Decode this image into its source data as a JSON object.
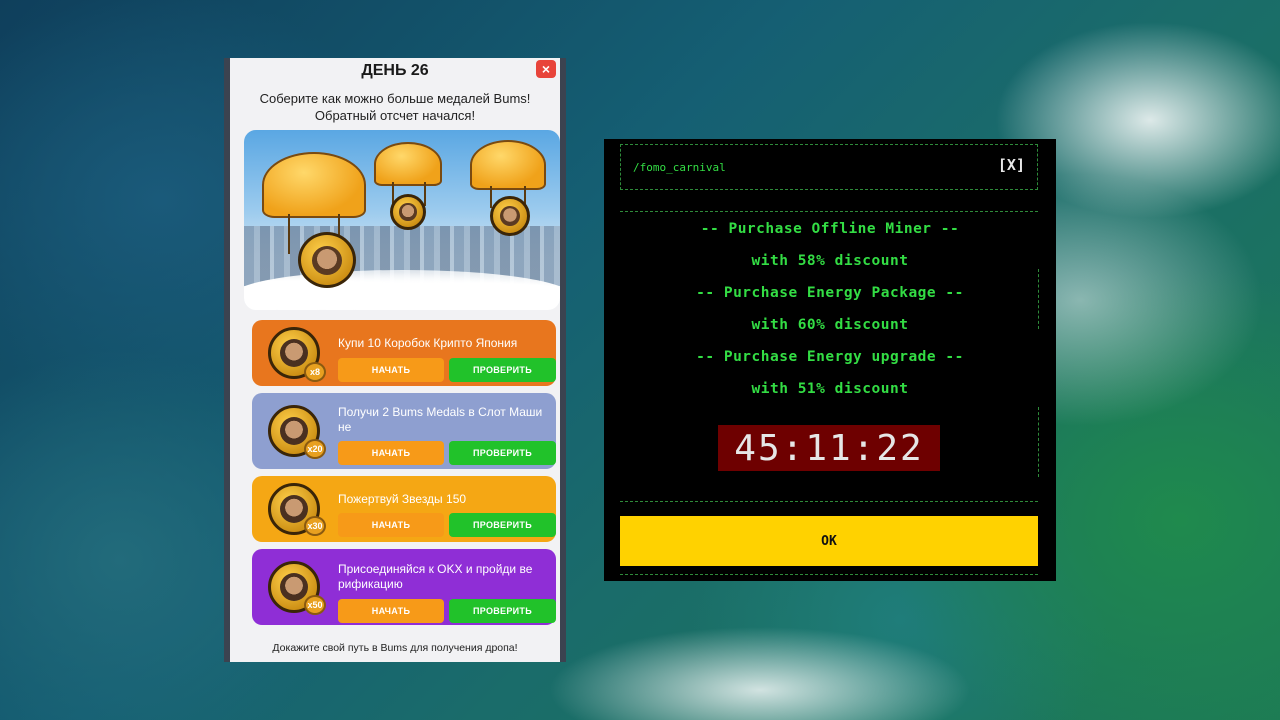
{
  "quest": {
    "title": "ДЕНЬ 26",
    "close_icon": "×",
    "subtitle_line1": "Соберите как можно больше медалей Bums!",
    "subtitle_line2": "Обратный отсчет начался!",
    "tasks": [
      {
        "title": "Купи 10 Коробок Крипто Япония",
        "multiplier": "x8",
        "start": "НАЧАТЬ",
        "check": "ПРОВЕРИТЬ",
        "color": "#e8761e"
      },
      {
        "title": "Получи 2 Bums Medals в Слот Маши не",
        "multiplier": "x20",
        "start": "НАЧАТЬ",
        "check": "ПРОВЕРИТЬ",
        "color": "#8e9fd0"
      },
      {
        "title": "Пожертвуй Звезды 150",
        "multiplier": "x30",
        "start": "НАЧАТЬ",
        "check": "ПРОВЕРИТЬ",
        "color": "#f5a714"
      },
      {
        "title": "Присоединяйся к OKX и пройди ве рификацию",
        "multiplier": "x50",
        "start": "НАЧАТЬ",
        "check": "ПРОВЕРИТЬ",
        "color": "#8f2ed6"
      }
    ],
    "footer": "Докажите свой путь в Bums для получения дропа!"
  },
  "terminal": {
    "path": "/fomo_carnival",
    "close_label": "[X]",
    "offers": [
      "-- Purchase Offline Miner --",
      "with 58% discount",
      "-- Purchase Energy Package --",
      "with 60% discount",
      "-- Purchase Energy upgrade --",
      "with 51% discount"
    ],
    "timer": "45:11:22",
    "ok_label": "OK"
  }
}
